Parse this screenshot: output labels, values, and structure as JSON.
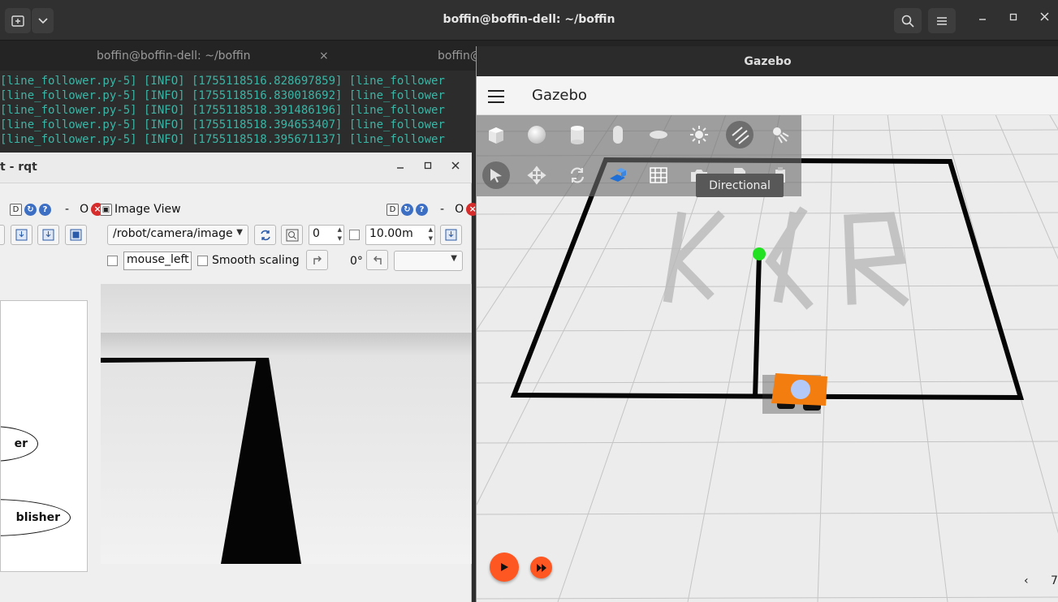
{
  "terminal": {
    "title": "boffin@boffin-dell: ~/boffin",
    "tabs": [
      {
        "label": "boffin@boffin-dell: ~/boffin",
        "close": "×"
      },
      {
        "label": "boffin@"
      }
    ],
    "lines": [
      "[line_follower.py-5] [INFO] [1755118516.828697859] [line_follower",
      "[line_follower.py-5] [INFO] [1755118516.830018692] [line_follower",
      "[line_follower.py-5] [INFO] [1755118518.391486196] [line_follower",
      "[line_follower.py-5] [INFO] [1755118518.394653407] [line_follower",
      "[line_follower.py-5] [INFO] [1755118518.395671137] [line_follower"
    ],
    "new_tab_icon": "new-tab-icon",
    "dropdown_icon": "chevron-down-icon",
    "search_icon": "search-icon",
    "menu_icon": "hamburger-icon"
  },
  "rqt": {
    "title": "t - rqt",
    "left_dock": {
      "d_label": "D",
      "dash": "-",
      "o_label": "O"
    },
    "image_view": {
      "title": "Image View",
      "d_label": "D",
      "dash": "-",
      "o_label": "O",
      "topic": "/robot/camera/image",
      "spin_value": "0",
      "distance": "10.00m",
      "mouse_field": "mouse_left",
      "smooth_label": "Smooth scaling",
      "rotation": "0°",
      "empty_combo": ""
    },
    "graph_nodes": [
      "er",
      "blisher"
    ]
  },
  "gazebo": {
    "window_title": "Gazebo",
    "app_name": "Gazebo",
    "tooltip": "Directional",
    "shapes": [
      "box-icon",
      "sphere-icon",
      "cylinder-icon",
      "capsule-icon",
      "ellipsoid-icon",
      "point-light-icon",
      "directional-light-icon",
      "spot-light-icon"
    ],
    "tools": [
      "select-icon",
      "translate-icon",
      "rotate-icon",
      "transform-icon",
      "grid-icon",
      "camera-icon",
      "copy-icon",
      "paste-icon"
    ],
    "nav_prev": "‹",
    "page_number": "7",
    "accent": "#ff5722"
  }
}
